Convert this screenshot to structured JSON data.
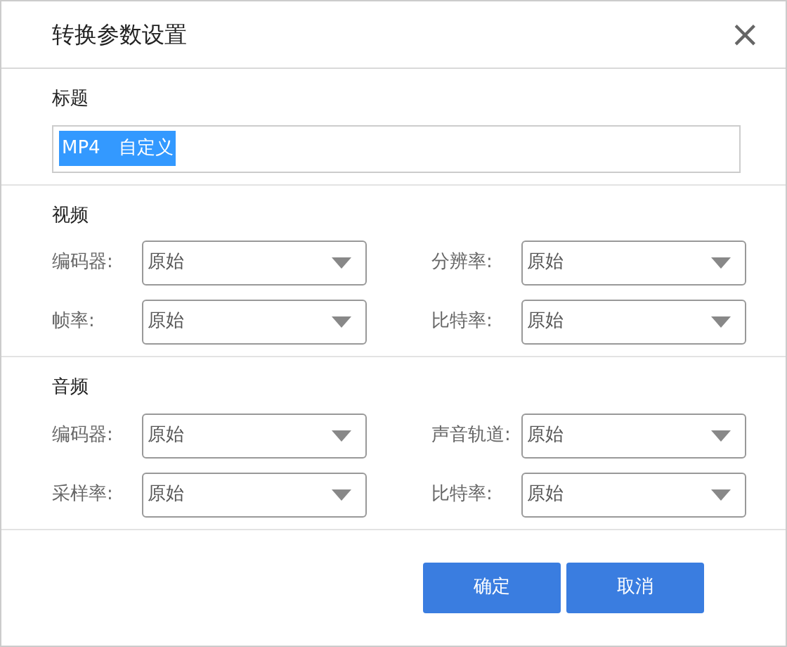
{
  "window": {
    "title": "转换参数设置",
    "close": "×"
  },
  "title_section": {
    "heading": "标题",
    "value": "MP4　自定义",
    "value_selected": true
  },
  "sections": [
    {
      "heading": "视频",
      "fields": [
        {
          "label": "编码器:",
          "value": "原始"
        },
        {
          "label": "分辨率:",
          "value": "原始"
        },
        {
          "label": "帧率:",
          "value": "原始"
        },
        {
          "label": "比特率:",
          "value": "原始"
        }
      ]
    },
    {
      "heading": "音频",
      "fields": [
        {
          "label": "编码器:",
          "value": "原始"
        },
        {
          "label": "声音轨道:",
          "value": "原始"
        },
        {
          "label": "采样率:",
          "value": "原始"
        },
        {
          "label": "比特率:",
          "value": "原始"
        }
      ]
    }
  ],
  "buttons": [
    "确定",
    "取消"
  ]
}
